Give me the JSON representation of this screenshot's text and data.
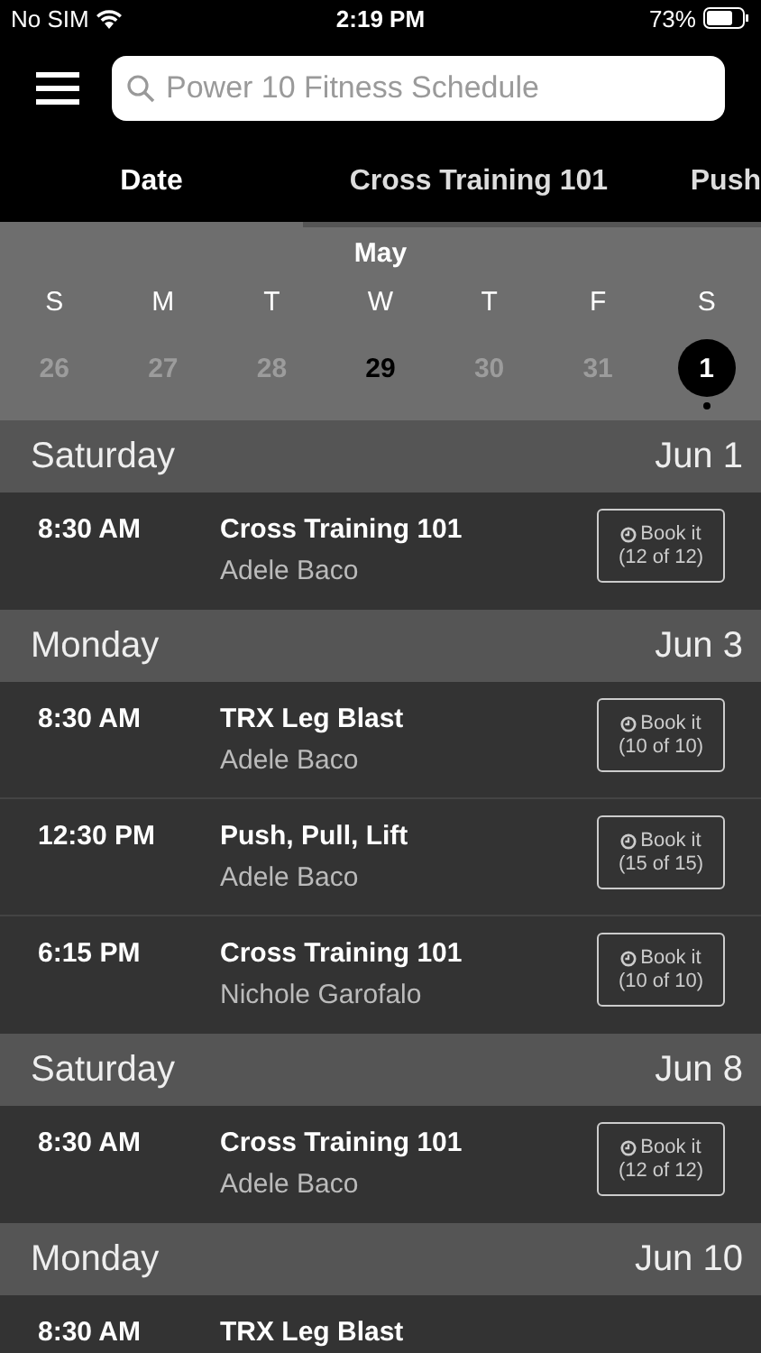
{
  "status_bar": {
    "carrier": "No SIM",
    "time": "2:19 PM",
    "battery": "73%"
  },
  "search": {
    "placeholder": "Power 10 Fitness Schedule"
  },
  "tabs": [
    {
      "label": "Date",
      "selected": true
    },
    {
      "label": "Cross Training 101",
      "selected": false
    },
    {
      "label": "Push",
      "selected": false
    }
  ],
  "calendar": {
    "month": "May",
    "weekdays": [
      "S",
      "M",
      "T",
      "W",
      "T",
      "F",
      "S"
    ],
    "days": [
      {
        "label": "26",
        "kind": "past",
        "selected": false,
        "has_events": false
      },
      {
        "label": "27",
        "kind": "past",
        "selected": false,
        "has_events": false
      },
      {
        "label": "28",
        "kind": "past",
        "selected": false,
        "has_events": false
      },
      {
        "label": "29",
        "kind": "today",
        "selected": false,
        "has_events": false
      },
      {
        "label": "30",
        "kind": "upcoming",
        "selected": false,
        "has_events": false
      },
      {
        "label": "31",
        "kind": "upcoming",
        "selected": false,
        "has_events": false
      },
      {
        "label": "1",
        "kind": "upcoming",
        "selected": true,
        "has_events": true
      }
    ]
  },
  "schedule": [
    {
      "day": "Saturday",
      "date": "Jun 1",
      "classes": [
        {
          "time": "8:30 AM",
          "title": "Cross Training 101",
          "instructor": "Adele Baco",
          "book_label": "Book it",
          "spots": "(12 of 12)"
        }
      ]
    },
    {
      "day": "Monday",
      "date": "Jun 3",
      "classes": [
        {
          "time": "8:30 AM",
          "title": "TRX Leg Blast",
          "instructor": "Adele Baco",
          "book_label": "Book it",
          "spots": "(10 of 10)"
        },
        {
          "time": "12:30 PM",
          "title": "Push, Pull, Lift",
          "instructor": "Adele Baco",
          "book_label": "Book it",
          "spots": "(15 of 15)"
        },
        {
          "time": "6:15 PM",
          "title": "Cross Training 101",
          "instructor": "Nichole Garofalo",
          "book_label": "Book it",
          "spots": "(10 of 10)"
        }
      ]
    },
    {
      "day": "Saturday",
      "date": "Jun 8",
      "classes": [
        {
          "time": "8:30 AM",
          "title": "Cross Training 101",
          "instructor": "Adele Baco",
          "book_label": "Book it",
          "spots": "(12 of 12)"
        }
      ]
    },
    {
      "day": "Monday",
      "date": "Jun 10",
      "classes": [
        {
          "time": "8:30 AM",
          "title": "TRX Leg Blast"
        }
      ]
    }
  ]
}
